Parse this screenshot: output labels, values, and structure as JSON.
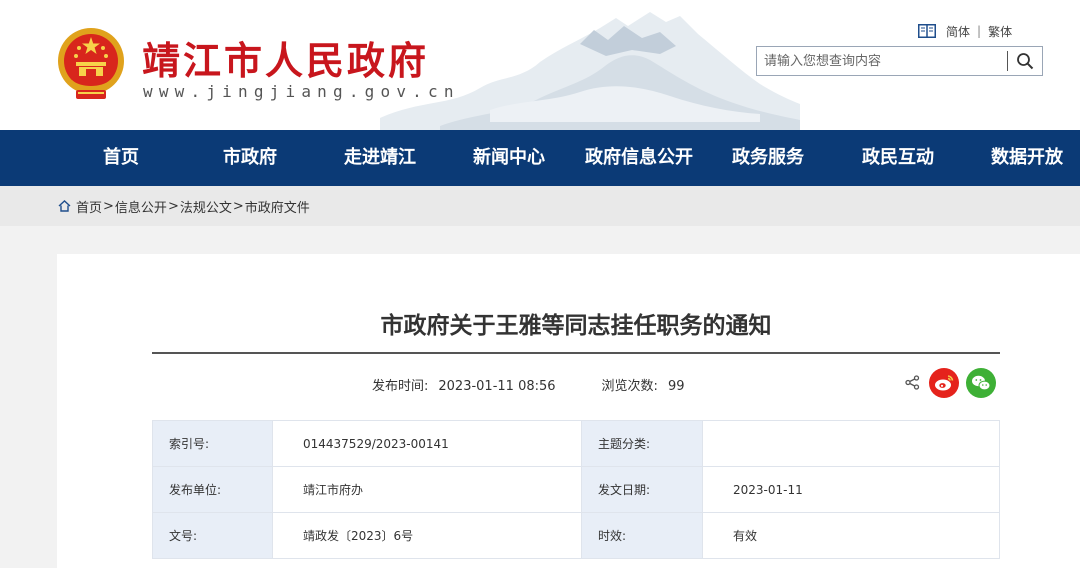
{
  "header": {
    "site_name": "靖江市人民政府",
    "site_url": "www.jingjiang.gov.cn",
    "lang": {
      "simplified": "简体",
      "separator": "|",
      "traditional": "繁体"
    },
    "search": {
      "placeholder": "请输入您想查询内容",
      "value": ""
    },
    "icons": {
      "emblem": "national-emblem-icon",
      "lang": "book-icon",
      "search": "search-icon"
    }
  },
  "nav": {
    "items": [
      "首页",
      "市政府",
      "走进靖江",
      "新闻中心",
      "政府信息公开",
      "政务服务",
      "政民互动",
      "数据开放"
    ]
  },
  "breadcrumb": {
    "icon": "home-icon",
    "items": [
      "首页",
      "信息公开",
      "法规公文",
      "市政府文件"
    ],
    "separator": ">"
  },
  "article": {
    "title": "市政府关于王雅等同志挂任职务的通知",
    "publish_label": "发布时间:",
    "publish_time": "2023-01-11 08:56",
    "views_label": "浏览次数:",
    "views": "99",
    "share_icons": [
      "share-icon",
      "weibo-icon",
      "wechat-icon"
    ]
  },
  "info_table": {
    "rows": [
      {
        "k1": "索引号:",
        "v1": "014437529/2023-00141",
        "k2": "主题分类:",
        "v2": ""
      },
      {
        "k1": "发布单位:",
        "v1": "靖江市府办",
        "k2": "发文日期:",
        "v2": "2023-01-11"
      },
      {
        "k1": "文号:",
        "v1": "靖政发〔2023〕6号",
        "k2": "时效:",
        "v2": "有效"
      }
    ]
  },
  "colors": {
    "brand_red": "#c8161d",
    "nav_blue": "#0b3a76",
    "table_key_bg": "#e8eef7",
    "weibo_red": "#e5231c",
    "wechat_green": "#3eb036"
  }
}
